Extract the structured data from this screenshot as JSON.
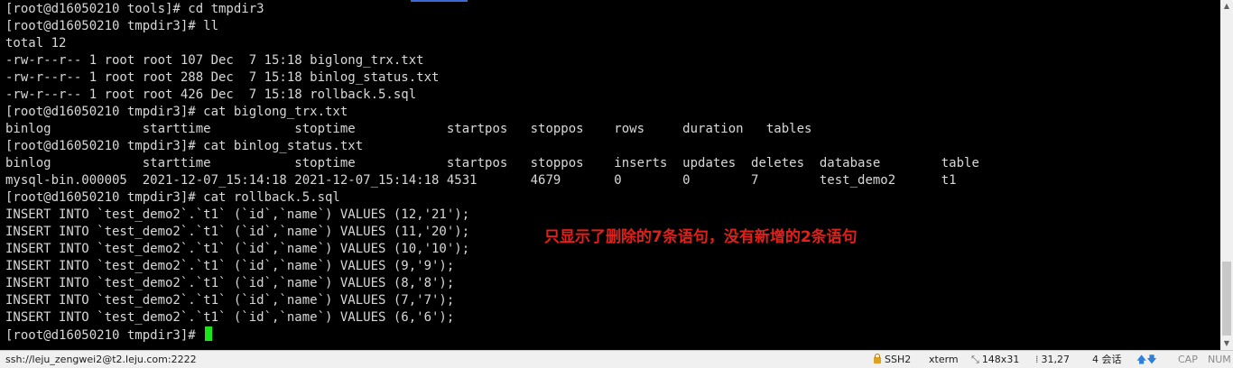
{
  "terminal": {
    "lines": [
      "[root@d16050210 tools]# cd tmpdir3",
      "[root@d16050210 tmpdir3]# ll",
      "total 12",
      "-rw-r--r-- 1 root root 107 Dec  7 15:18 biglong_trx.txt",
      "-rw-r--r-- 1 root root 288 Dec  7 15:18 binlog_status.txt",
      "-rw-r--r-- 1 root root 426 Dec  7 15:18 rollback.5.sql",
      "[root@d16050210 tmpdir3]# cat biglong_trx.txt",
      "binlog            starttime           stoptime            startpos   stoppos    rows     duration   tables",
      "[root@d16050210 tmpdir3]# cat binlog_status.txt",
      "binlog            starttime           stoptime            startpos   stoppos    inserts  updates  deletes  database        table",
      "mysql-bin.000005  2021-12-07_15:14:18 2021-12-07_15:14:18 4531       4679       0        0        7        test_demo2      t1",
      "[root@d16050210 tmpdir3]# cat rollback.5.sql",
      "INSERT INTO `test_demo2`.`t1` (`id`,`name`) VALUES (12,'21');",
      "INSERT INTO `test_demo2`.`t1` (`id`,`name`) VALUES (11,'20');",
      "INSERT INTO `test_demo2`.`t1` (`id`,`name`) VALUES (10,'10');",
      "INSERT INTO `test_demo2`.`t1` (`id`,`name`) VALUES (9,'9');",
      "INSERT INTO `test_demo2`.`t1` (`id`,`name`) VALUES (8,'8');",
      "INSERT INTO `test_demo2`.`t1` (`id`,`name`) VALUES (7,'7');",
      "INSERT INTO `test_demo2`.`t1` (`id`,`name`) VALUES (6,'6');"
    ],
    "prompt": "[root@d16050210 tmpdir3]# ",
    "annotation": "只显示了删除的7条语句，没有新增的2条语句"
  },
  "statusbar": {
    "connection": "ssh://leju_zengwei2@t2.leju.com:2222",
    "protocol": "SSH2",
    "term_type": "xterm",
    "size": "148x31",
    "cursor_pos": "31,27",
    "sessions": "4 会话",
    "cap": "CAP",
    "num": "NUM"
  },
  "colors": {
    "background": "#000000",
    "text": "#d8d8d8",
    "cursor": "#19e619",
    "annotation": "#e0201a"
  }
}
